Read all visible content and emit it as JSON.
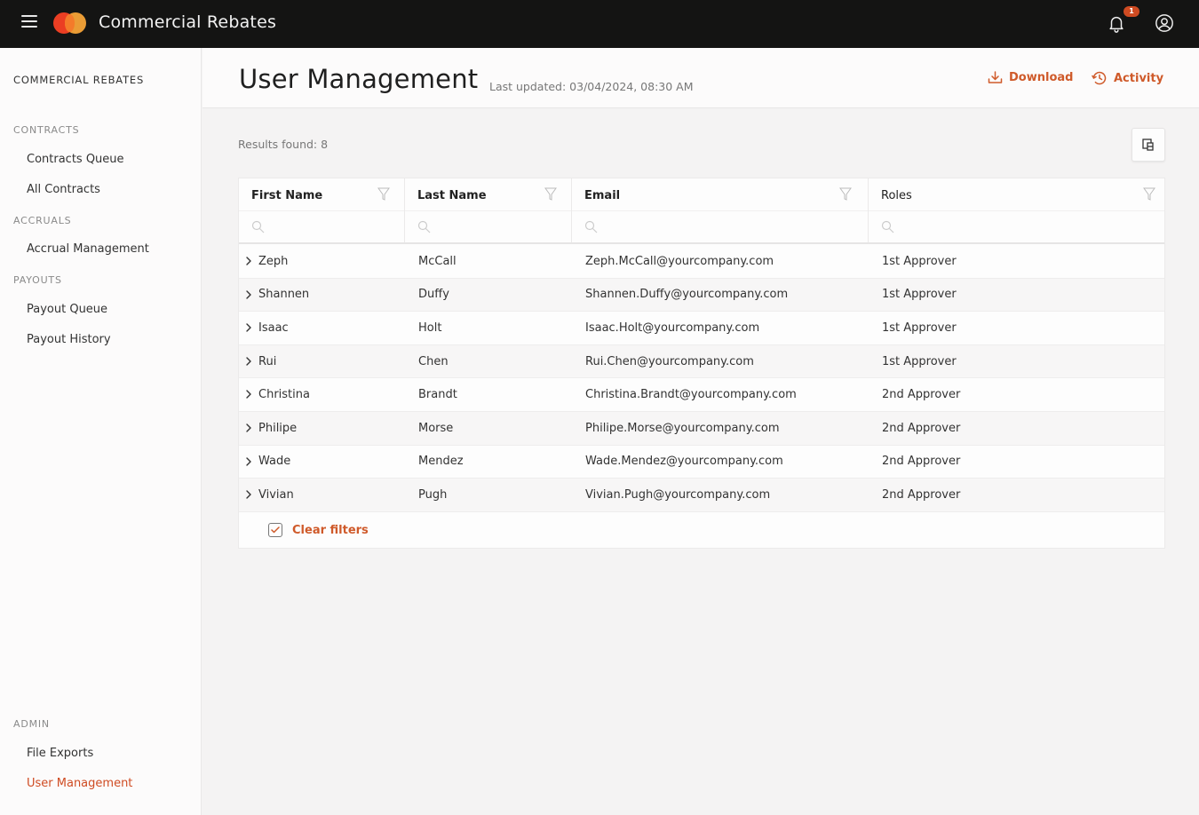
{
  "app": {
    "title": "Commercial Rebates",
    "notification_count": "1",
    "icons": {
      "menu": "hamburger-icon",
      "logo": "mastercard-logo",
      "notifications": "bell-icon",
      "account": "user-circle-icon"
    }
  },
  "sidebar": {
    "title": "COMMERCIAL REBATES",
    "sections": [
      {
        "label": "CONTRACTS",
        "items": [
          {
            "label": "Contracts Queue"
          },
          {
            "label": "All Contracts"
          }
        ]
      },
      {
        "label": "ACCRUALS",
        "items": [
          {
            "label": "Accrual Management"
          }
        ]
      },
      {
        "label": "PAYOUTS",
        "items": [
          {
            "label": "Payout Queue"
          },
          {
            "label": "Payout History"
          }
        ]
      },
      {
        "label": "ADMIN",
        "items": [
          {
            "label": "File Exports"
          },
          {
            "label": "User Management",
            "active": true
          }
        ]
      }
    ]
  },
  "header": {
    "title": "User Management",
    "last_updated": "Last updated: 03/04/2024, 08:30 AM",
    "download_label": "Download",
    "activity_label": "Activity"
  },
  "colors": {
    "accent": "#cf5a2a",
    "topbar": "#141413",
    "badge": "#cf4b22"
  },
  "main": {
    "results_text": "Results found: 8",
    "columns": [
      {
        "label": "First Name",
        "search_placeholder": ""
      },
      {
        "label": "Last Name",
        "search_placeholder": ""
      },
      {
        "label": "Email",
        "search_placeholder": ""
      },
      {
        "label": "Roles",
        "search_placeholder": ""
      }
    ],
    "rows": [
      {
        "first": "Zeph",
        "last": "McCall",
        "email": "Zeph.McCall@yourcompany.com",
        "role": "1st Approver"
      },
      {
        "first": "Shannen",
        "last": "Duffy",
        "email": "Shannen.Duffy@yourcompany.com",
        "role": "1st Approver"
      },
      {
        "first": "Isaac",
        "last": "Holt",
        "email": "Isaac.Holt@yourcompany.com",
        "role": "1st Approver"
      },
      {
        "first": "Rui",
        "last": "Chen",
        "email": "Rui.Chen@yourcompany.com",
        "role": "1st Approver"
      },
      {
        "first": "Christina",
        "last": "Brandt",
        "email": "Christina.Brandt@yourcompany.com",
        "role": "2nd Approver"
      },
      {
        "first": "Philipe",
        "last": "Morse",
        "email": "Philipe.Morse@yourcompany.com",
        "role": "2nd Approver"
      },
      {
        "first": "Wade",
        "last": "Mendez",
        "email": "Wade.Mendez@yourcompany.com",
        "role": "2nd Approver"
      },
      {
        "first": "Vivian",
        "last": "Pugh",
        "email": "Vivian.Pugh@yourcompany.com",
        "role": "2nd Approver"
      }
    ],
    "clear_filters_label": "Clear filters"
  }
}
